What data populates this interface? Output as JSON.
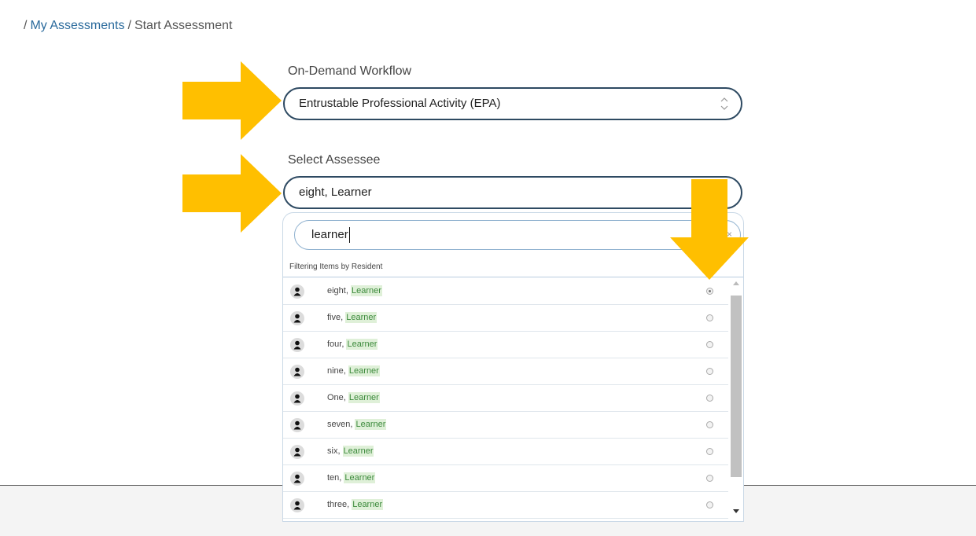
{
  "breadcrumb": {
    "sep1": "/",
    "link": "My Assessments",
    "sep2": "/",
    "current": "Start Assessment"
  },
  "workflow": {
    "label": "On-Demand Workflow",
    "value": "Entrustable Professional Activity (EPA)"
  },
  "assessee": {
    "label": "Select Assessee",
    "value": "eight, Learner",
    "search_value": "learner",
    "clear": "×",
    "filter_label": "Filtering Items by Resident",
    "items": [
      {
        "first": "eight,",
        "last": "Learner",
        "selected": true
      },
      {
        "first": "five,",
        "last": "Learner",
        "selected": false
      },
      {
        "first": "four,",
        "last": "Learner",
        "selected": false
      },
      {
        "first": "nine,",
        "last": "Learner",
        "selected": false
      },
      {
        "first": "One,",
        "last": "Learner",
        "selected": false
      },
      {
        "first": "seven,",
        "last": "Learner",
        "selected": false
      },
      {
        "first": "six,",
        "last": "Learner",
        "selected": false
      },
      {
        "first": "ten,",
        "last": "Learner",
        "selected": false
      },
      {
        "first": "three,",
        "last": "Learner",
        "selected": false
      }
    ]
  },
  "colors": {
    "annotation_arrow": "#ffbf00",
    "link": "#2a6a9c",
    "field_border": "#2e4a62",
    "highlight": "#dff0d8"
  }
}
